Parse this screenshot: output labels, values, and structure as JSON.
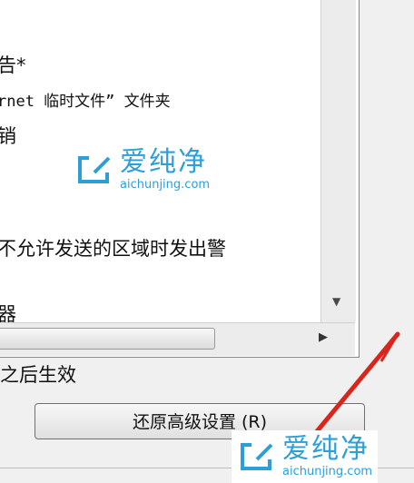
{
  "list": {
    "items": [
      "告*",
      "rnet 临时文件” 文件夹",
      "销",
      "不允许发送的区域时发出警",
      "器"
    ]
  },
  "note": "之后生效",
  "buttons": {
    "restore": "还原高级设置 (R)"
  },
  "watermark": {
    "brand": "爱纯净",
    "url": "aichunjing.com"
  },
  "colors": {
    "watermark": "#2c9fd8",
    "annotation_arrow": "#d9261c"
  }
}
